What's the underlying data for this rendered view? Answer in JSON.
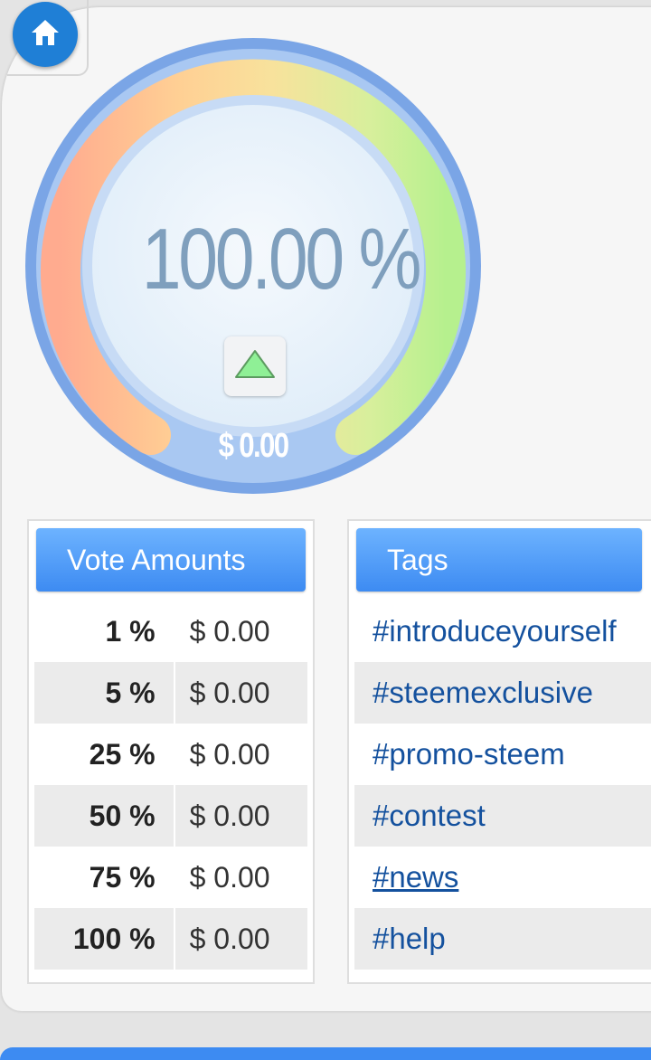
{
  "gauge": {
    "percent_text": "100.00 %",
    "value_text": "$ 0.00",
    "percent": 100
  },
  "vote_amounts": {
    "title": "Vote Amounts",
    "rows": [
      {
        "pct": "1 %",
        "amt": "$ 0.00"
      },
      {
        "pct": "5 %",
        "amt": "$ 0.00"
      },
      {
        "pct": "25 %",
        "amt": "$ 0.00"
      },
      {
        "pct": "50 %",
        "amt": "$ 0.00"
      },
      {
        "pct": "75 %",
        "amt": "$ 0.00"
      },
      {
        "pct": "100 %",
        "amt": "$ 0.00"
      }
    ]
  },
  "tags": {
    "title": "Tags",
    "items": [
      "#introduceyourself",
      "#steemexclusive",
      "#promo-steem",
      "#contest",
      "#news",
      "#help"
    ]
  },
  "colors": {
    "accent": "#3d8bf2",
    "link": "#14519e"
  },
  "icons": {
    "home": "home-icon",
    "up": "triangle-up-icon"
  }
}
